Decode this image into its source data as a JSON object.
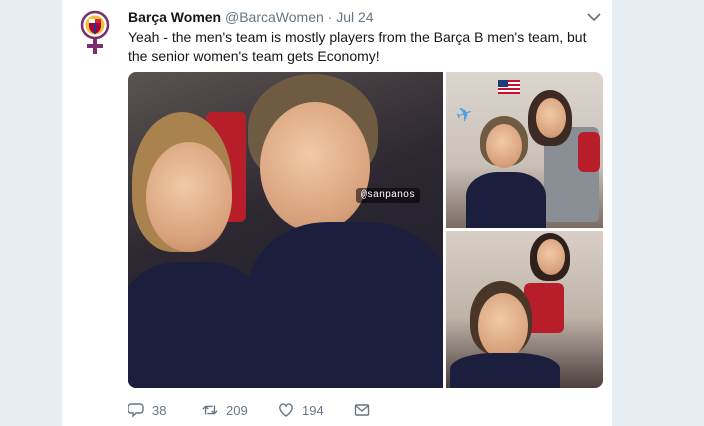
{
  "tweet": {
    "display_name": "Barça Women",
    "handle": "@BarcaWomen",
    "separator": "·",
    "date": "Jul 24",
    "text": "Yeah - the men's team is mostly players from the Barça B men's team, but the senior women's team gets Economy!"
  },
  "media": {
    "instagram_tag": "@sanpanos"
  },
  "actions": {
    "replies": "38",
    "retweets": "209",
    "likes": "194"
  },
  "colors": {
    "accent": "#1da1f2",
    "barca_blue": "#1f3b7a",
    "barca_red": "#a50044",
    "venus_symbol": "#7b2d6d"
  },
  "icons": [
    "barca-women-logo-icon",
    "chevron-down-icon",
    "reply-icon",
    "retweet-icon",
    "like-icon",
    "message-icon",
    "airplane-icon",
    "us-flag-icon"
  ]
}
